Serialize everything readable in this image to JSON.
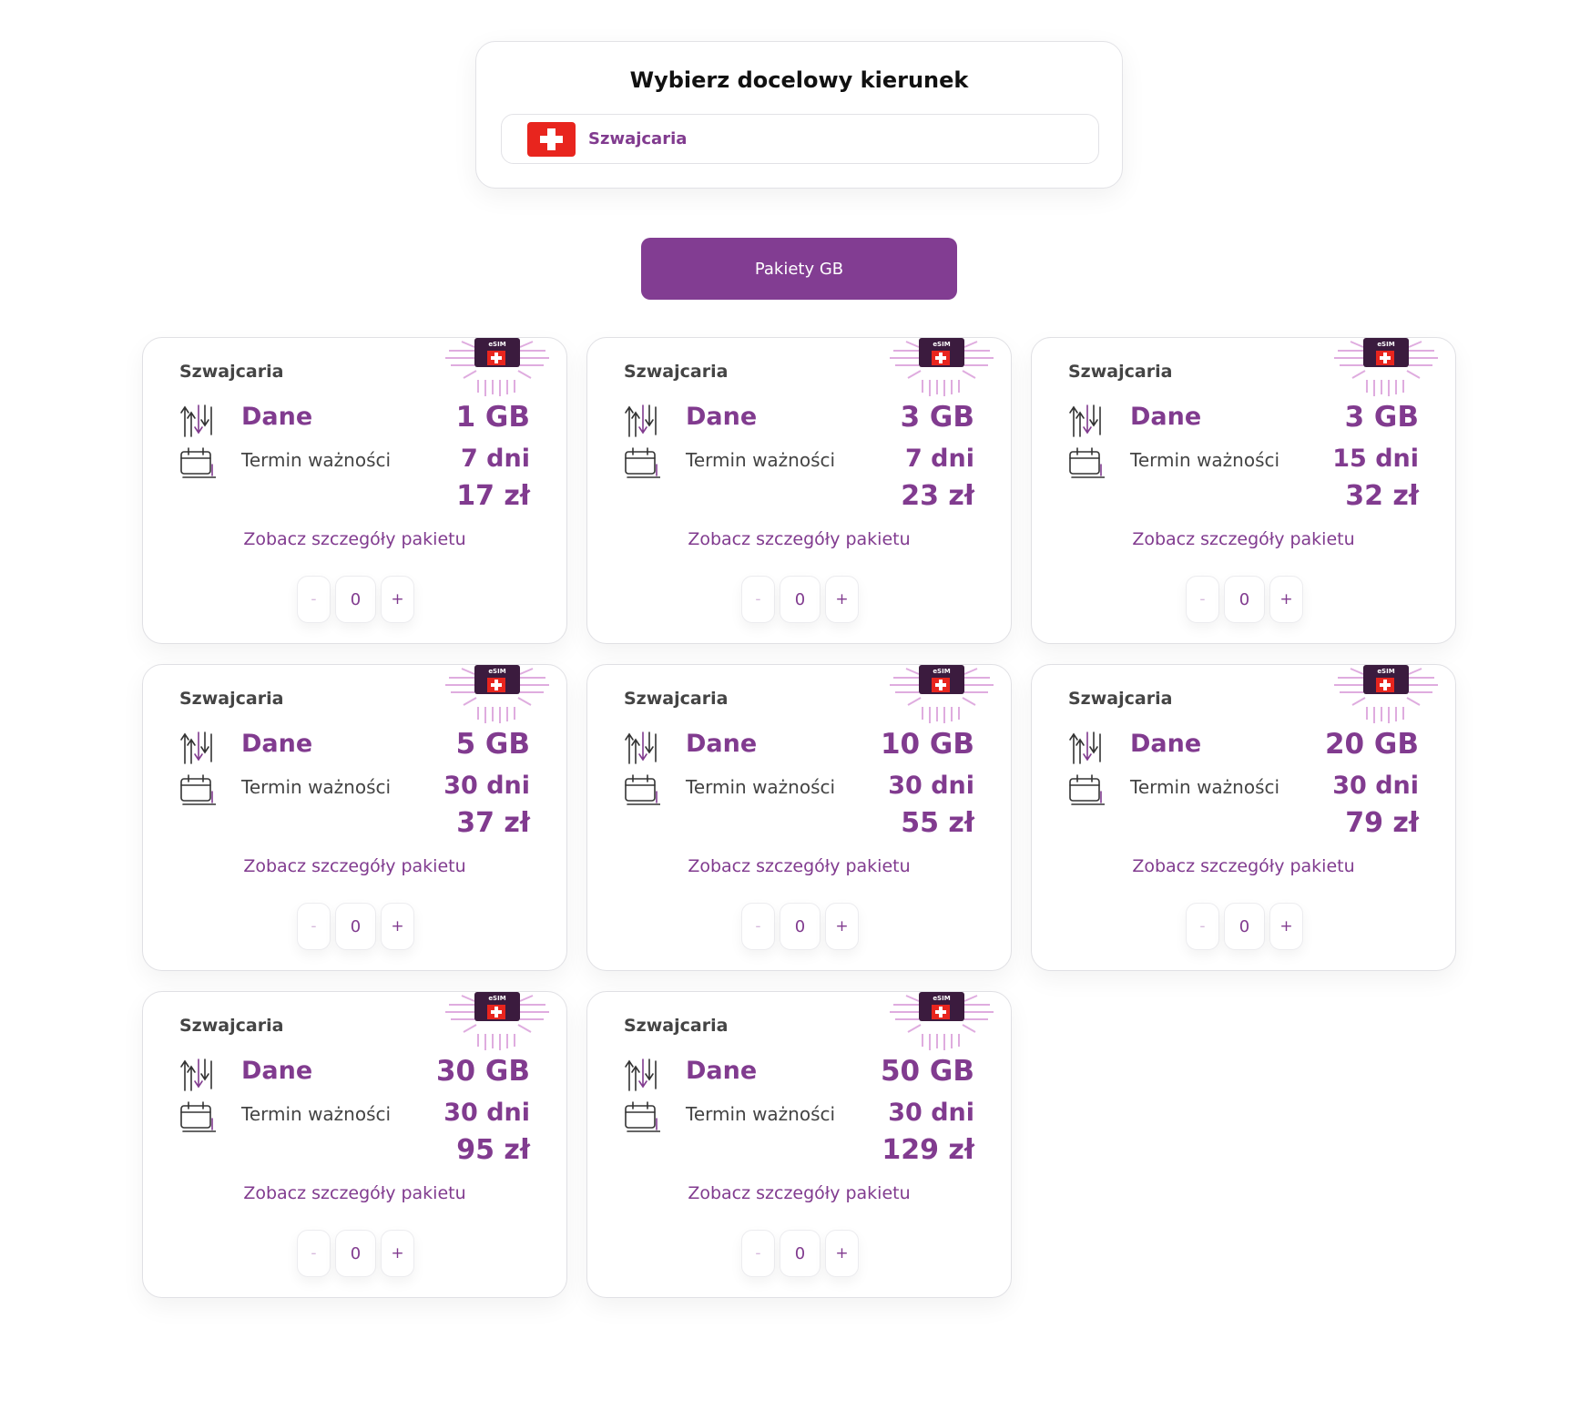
{
  "destination": {
    "title": "Wybierz docelowy kierunek",
    "selected": "Szwajcaria",
    "flag_icon": "swiss-flag-icon"
  },
  "tabs": {
    "active_label": "Pakiety GB"
  },
  "colors": {
    "accent": "#813b8f",
    "button": "#823d92",
    "flag_red": "#e8251e"
  },
  "packages": [
    {
      "country": "Szwajcaria",
      "data_label": "Dane",
      "data": "1 GB",
      "validity_label": "Termin ważności",
      "validity": "7 dni",
      "price": "17 zł",
      "details": "Zobacz szczegóły pakietu",
      "minus": "-",
      "qty": "0",
      "plus": "+"
    },
    {
      "country": "Szwajcaria",
      "data_label": "Dane",
      "data": "3 GB",
      "validity_label": "Termin ważności",
      "validity": "7 dni",
      "price": "23 zł",
      "details": "Zobacz szczegóły pakietu",
      "minus": "-",
      "qty": "0",
      "plus": "+"
    },
    {
      "country": "Szwajcaria",
      "data_label": "Dane",
      "data": "3 GB",
      "validity_label": "Termin ważności",
      "validity": "15 dni",
      "price": "32 zł",
      "details": "Zobacz szczegóły pakietu",
      "minus": "-",
      "qty": "0",
      "plus": "+"
    },
    {
      "country": "Szwajcaria",
      "data_label": "Dane",
      "data": "5 GB",
      "validity_label": "Termin ważności",
      "validity": "30 dni",
      "price": "37 zł",
      "details": "Zobacz szczegóły pakietu",
      "minus": "-",
      "qty": "0",
      "plus": "+"
    },
    {
      "country": "Szwajcaria",
      "data_label": "Dane",
      "data": "10 GB",
      "validity_label": "Termin ważności",
      "validity": "30 dni",
      "price": "55 zł",
      "details": "Zobacz szczegóły pakietu",
      "minus": "-",
      "qty": "0",
      "plus": "+"
    },
    {
      "country": "Szwajcaria",
      "data_label": "Dane",
      "data": "20 GB",
      "validity_label": "Termin ważności",
      "validity": "30 dni",
      "price": "79 zł",
      "details": "Zobacz szczegóły pakietu",
      "minus": "-",
      "qty": "0",
      "plus": "+"
    },
    {
      "country": "Szwajcaria",
      "data_label": "Dane",
      "data": "30 GB",
      "validity_label": "Termin ważności",
      "validity": "30 dni",
      "price": "95 zł",
      "details": "Zobacz szczegóły pakietu",
      "minus": "-",
      "qty": "0",
      "plus": "+"
    },
    {
      "country": "Szwajcaria",
      "data_label": "Dane",
      "data": "50 GB",
      "validity_label": "Termin ważności",
      "validity": "30 dni",
      "price": "129 zł",
      "details": "Zobacz szczegóły pakietu",
      "minus": "-",
      "qty": "0",
      "plus": "+"
    }
  ],
  "esim_badge": {
    "label": "eSIM",
    "icon": "esim-chip-icon"
  }
}
